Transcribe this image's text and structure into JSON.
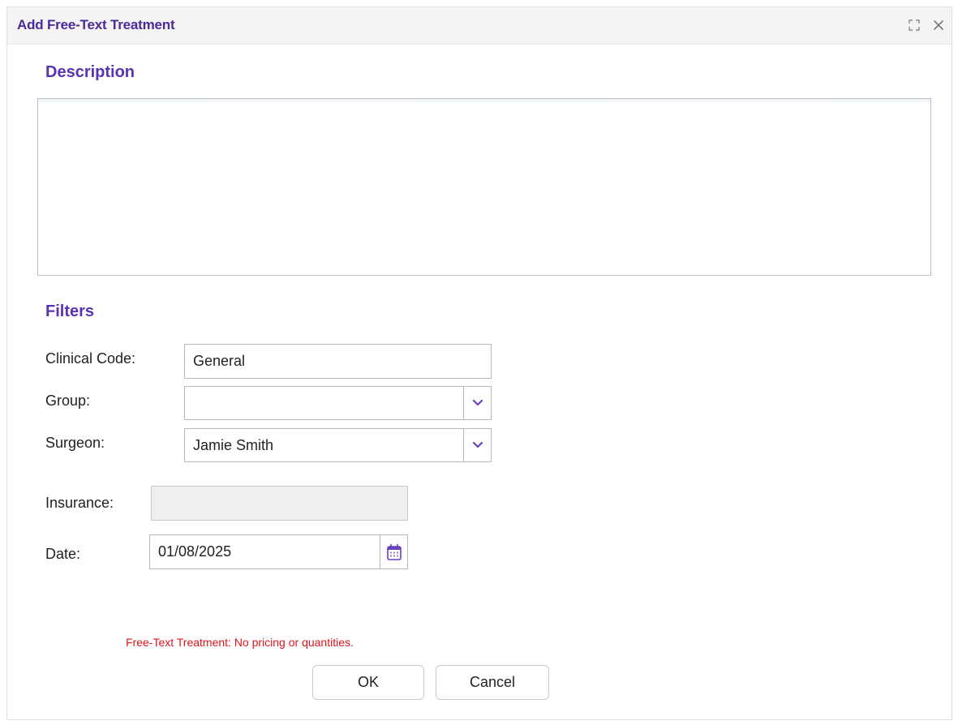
{
  "dialog": {
    "title": "Add Free-Text Treatment",
    "title_buttons": [
      "expand-icon",
      "close-icon"
    ]
  },
  "description": {
    "label": "Description",
    "value": ""
  },
  "filters": {
    "label": "Filters",
    "clinical_code": {
      "label": "Clinical Code:",
      "value": "General"
    },
    "group": {
      "label": "Group:",
      "value": ""
    },
    "surgeon": {
      "label": "Surgeon:",
      "value": "Jamie Smith"
    },
    "insurance": {
      "label": "Insurance:",
      "value": ""
    },
    "date": {
      "label": "Date:",
      "value": "01/08/2025"
    }
  },
  "warning": "Free-Text Treatment: No pricing or quantities.",
  "buttons": {
    "ok": "OK",
    "cancel": "Cancel"
  },
  "colors": {
    "accent": "#5a33b5",
    "title": "#4b2a9a",
    "warning": "#e0141c",
    "chevron": "#6a3fc0"
  }
}
